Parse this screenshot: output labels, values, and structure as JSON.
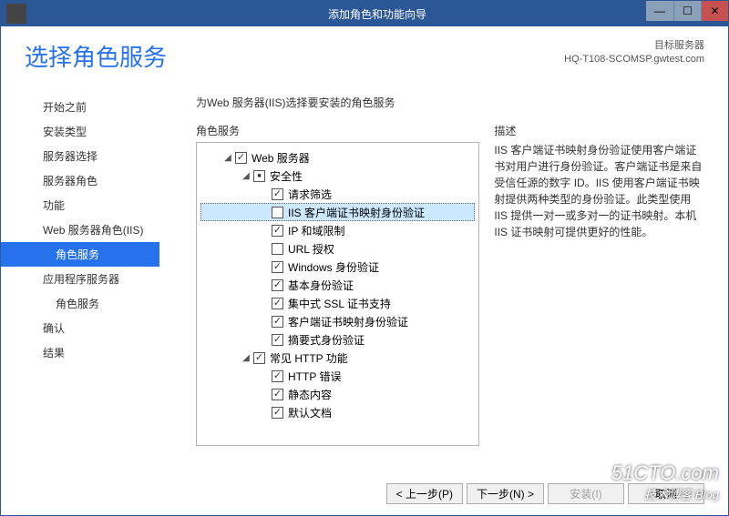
{
  "window": {
    "title": "添加角色和功能向导"
  },
  "header": {
    "page_title": "选择角色服务",
    "target_label": "目标服务器",
    "target_value": "HQ-T108-SCOMSP.gwtest.com"
  },
  "sidebar": {
    "items": [
      {
        "label": "开始之前",
        "active": false,
        "sub": false
      },
      {
        "label": "安装类型",
        "active": false,
        "sub": false
      },
      {
        "label": "服务器选择",
        "active": false,
        "sub": false
      },
      {
        "label": "服务器角色",
        "active": false,
        "sub": false
      },
      {
        "label": "功能",
        "active": false,
        "sub": false
      },
      {
        "label": "Web 服务器角色(IIS)",
        "active": false,
        "sub": false
      },
      {
        "label": "角色服务",
        "active": true,
        "sub": true
      },
      {
        "label": "应用程序服务器",
        "active": false,
        "sub": false
      },
      {
        "label": "角色服务",
        "active": false,
        "sub": true
      },
      {
        "label": "确认",
        "active": false,
        "sub": false
      },
      {
        "label": "结果",
        "active": false,
        "sub": false
      }
    ]
  },
  "content": {
    "instruction": "为Web 服务器(IIS)选择要安装的角色服务",
    "roles_label": "角色服务",
    "desc_label": "描述",
    "desc_text": "IIS 客户端证书映射身份验证使用客户端证书对用户进行身份验证。客户端证书是来自受信任源的数字 ID。IIS 使用客户端证书映射提供两种类型的身份验证。此类型使用 IIS 提供一对一或多对一的证书映射。本机 IIS 证书映射可提供更好的性能。",
    "tree": [
      {
        "indent": 1,
        "expander": "◢",
        "check": "checked",
        "label": "Web 服务器",
        "selected": false
      },
      {
        "indent": 2,
        "expander": "◢",
        "check": "mixed",
        "label": "安全性",
        "selected": false
      },
      {
        "indent": 3,
        "expander": "",
        "check": "checked",
        "label": "请求筛选",
        "selected": false
      },
      {
        "indent": 3,
        "expander": "",
        "check": "none",
        "label": "IIS 客户端证书映射身份验证",
        "selected": true
      },
      {
        "indent": 3,
        "expander": "",
        "check": "checked",
        "label": "IP 和域限制",
        "selected": false
      },
      {
        "indent": 3,
        "expander": "",
        "check": "none",
        "label": "URL 授权",
        "selected": false
      },
      {
        "indent": 3,
        "expander": "",
        "check": "checked",
        "label": "Windows 身份验证",
        "selected": false
      },
      {
        "indent": 3,
        "expander": "",
        "check": "checked",
        "label": "基本身份验证",
        "selected": false
      },
      {
        "indent": 3,
        "expander": "",
        "check": "checked",
        "label": "集中式 SSL 证书支持",
        "selected": false
      },
      {
        "indent": 3,
        "expander": "",
        "check": "checked",
        "label": "客户端证书映射身份验证",
        "selected": false
      },
      {
        "indent": 3,
        "expander": "",
        "check": "checked",
        "label": "摘要式身份验证",
        "selected": false
      },
      {
        "indent": 2,
        "expander": "◢",
        "check": "checked",
        "label": "常见 HTTP 功能",
        "selected": false
      },
      {
        "indent": 3,
        "expander": "",
        "check": "checked",
        "label": "HTTP 错误",
        "selected": false
      },
      {
        "indent": 3,
        "expander": "",
        "check": "checked",
        "label": "静态内容",
        "selected": false
      },
      {
        "indent": 3,
        "expander": "",
        "check": "checked",
        "label": "默认文档",
        "selected": false
      }
    ]
  },
  "footer": {
    "previous": "< 上一步(P)",
    "next": "下一步(N) >",
    "install": "安装(I)",
    "cancel": "取消"
  },
  "watermark": {
    "main": "51CTO.com",
    "sub": "技术博客 Blog"
  }
}
